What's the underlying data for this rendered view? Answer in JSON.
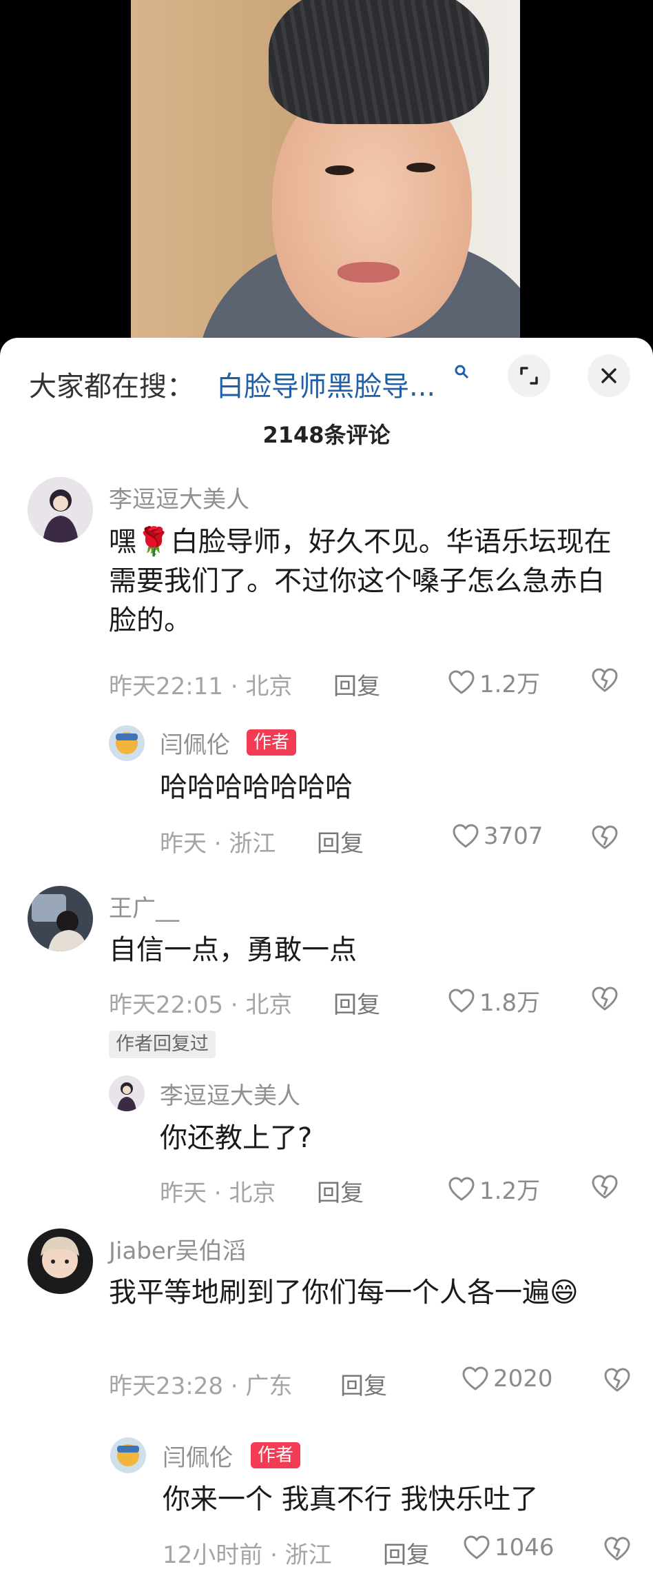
{
  "search": {
    "prefix": "大家都在搜：",
    "term": "白脸导师黑脸导..."
  },
  "comment_count": "2148条评论",
  "comments": [
    {
      "user": "李逗逗大美人",
      "text": "嘿🌹白脸导师，好久不见。华语乐坛现在需要我们了。不过你这个嗓子怎么急赤白脸的。",
      "meta": "昨天22:11 · 北京",
      "reply": "回复",
      "likes": "1.2万",
      "replies": [
        {
          "user": "闫佩伦",
          "badge": "作者",
          "text": "哈哈哈哈哈哈哈",
          "meta": "昨天 · 浙江",
          "reply": "回复",
          "likes": "3707"
        }
      ]
    },
    {
      "user": "王广__",
      "text": "自信一点，勇敢一点",
      "meta": "昨天22:05 · 北京",
      "reply": "回复",
      "likes": "1.8万",
      "tag": "作者回复过",
      "replies": [
        {
          "user": "李逗逗大美人",
          "text": "你还教上了?",
          "meta": "昨天 · 北京",
          "reply": "回复",
          "likes": "1.2万"
        }
      ]
    },
    {
      "user": "Jiaber吴伯滔",
      "text": "我平等地刷到了你们每一个人各一遍😄",
      "meta": "昨天23:28 · 广东",
      "reply": "回复",
      "likes": "2020",
      "replies": [
        {
          "user": "闫佩伦",
          "badge": "作者",
          "text": "你来一个 我真不行 我快乐吐了",
          "meta": "12小时前 · 浙江",
          "reply": "回复",
          "likes": "1046"
        }
      ]
    }
  ],
  "colors": {
    "link": "#1f5fa8",
    "author_badge": "#f33b54",
    "meta": "#a3a3a8"
  },
  "icons": [
    "expand-icon",
    "close-icon",
    "heart-icon",
    "broken-heart-icon"
  ]
}
